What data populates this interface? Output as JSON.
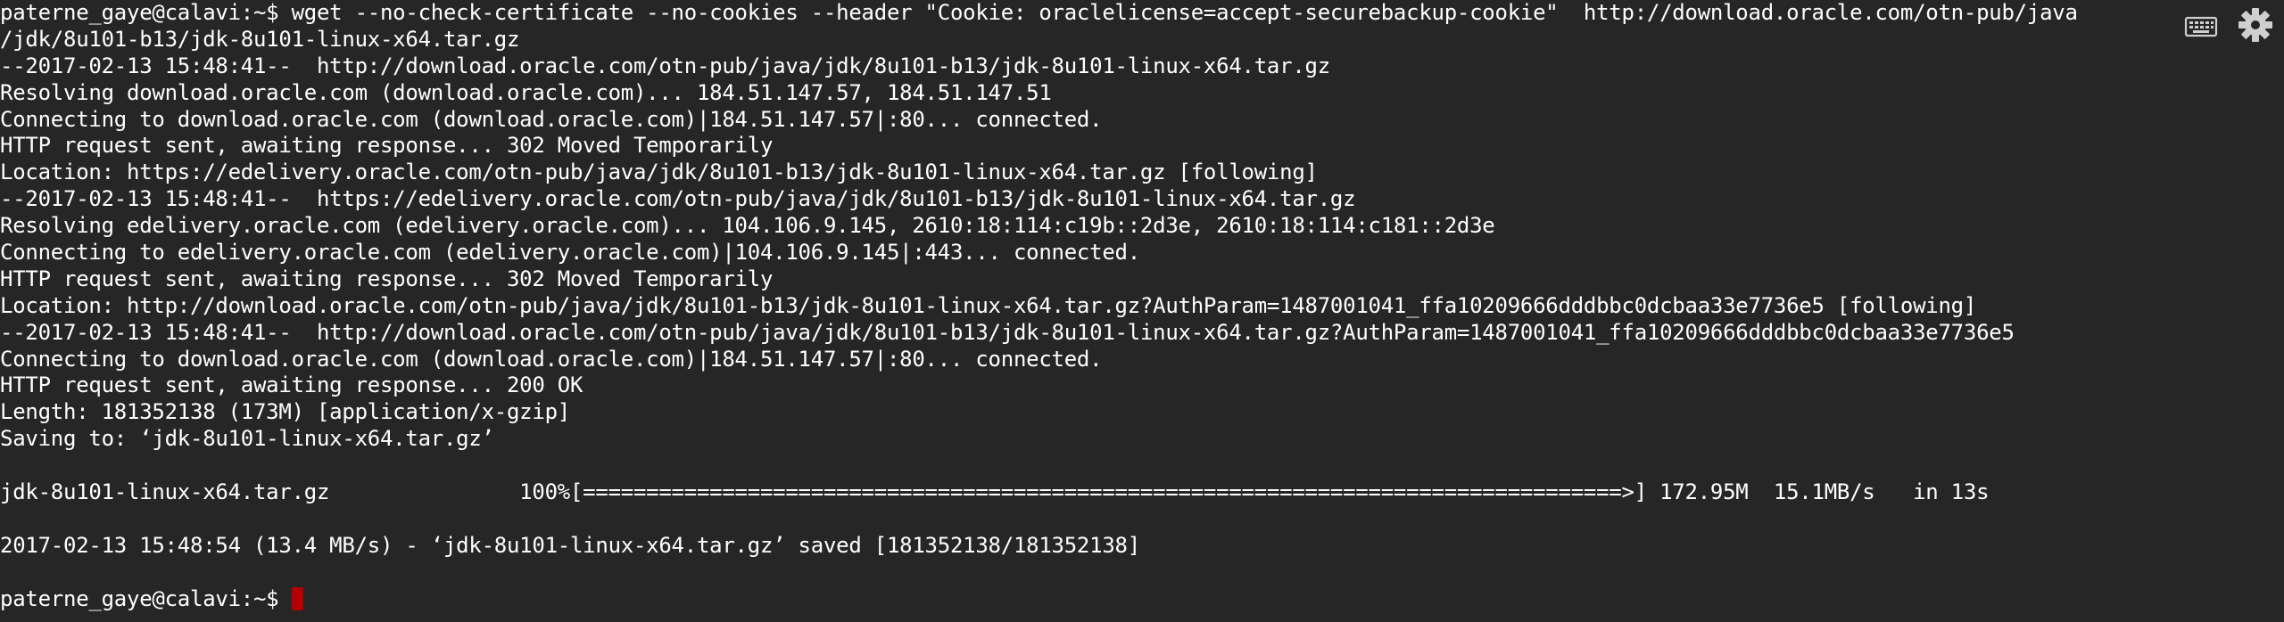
{
  "terminal": {
    "lines": [
      "paterne_gaye@calavi:~$ wget --no-check-certificate --no-cookies --header \"Cookie: oraclelicense=accept-securebackup-cookie\"  http://download.oracle.com/otn-pub/java",
      "/jdk/8u101-b13/jdk-8u101-linux-x64.tar.gz",
      "--2017-02-13 15:48:41--  http://download.oracle.com/otn-pub/java/jdk/8u101-b13/jdk-8u101-linux-x64.tar.gz",
      "Resolving download.oracle.com (download.oracle.com)... 184.51.147.57, 184.51.147.51",
      "Connecting to download.oracle.com (download.oracle.com)|184.51.147.57|:80... connected.",
      "HTTP request sent, awaiting response... 302 Moved Temporarily",
      "Location: https://edelivery.oracle.com/otn-pub/java/jdk/8u101-b13/jdk-8u101-linux-x64.tar.gz [following]",
      "--2017-02-13 15:48:41--  https://edelivery.oracle.com/otn-pub/java/jdk/8u101-b13/jdk-8u101-linux-x64.tar.gz",
      "Resolving edelivery.oracle.com (edelivery.oracle.com)... 104.106.9.145, 2610:18:114:c19b::2d3e, 2610:18:114:c181::2d3e",
      "Connecting to edelivery.oracle.com (edelivery.oracle.com)|104.106.9.145|:443... connected.",
      "HTTP request sent, awaiting response... 302 Moved Temporarily",
      "Location: http://download.oracle.com/otn-pub/java/jdk/8u101-b13/jdk-8u101-linux-x64.tar.gz?AuthParam=1487001041_ffa10209666dddbbc0dcbaa33e7736e5 [following]",
      "--2017-02-13 15:48:41--  http://download.oracle.com/otn-pub/java/jdk/8u101-b13/jdk-8u101-linux-x64.tar.gz?AuthParam=1487001041_ffa10209666dddbbc0dcbaa33e7736e5",
      "Connecting to download.oracle.com (download.oracle.com)|184.51.147.57|:80... connected.",
      "HTTP request sent, awaiting response... 200 OK",
      "Length: 181352138 (173M) [application/x-gzip]",
      "Saving to: ‘jdk-8u101-linux-x64.tar.gz’",
      "",
      "jdk-8u101-linux-x64.tar.gz               100%[==================================================================================>] 172.95M  15.1MB/s   in 13s",
      "",
      "2017-02-13 15:48:54 (13.4 MB/s) - ‘jdk-8u101-linux-x64.tar.gz’ saved [181352138/181352138]",
      ""
    ],
    "prompt": "paterne_gaye@calavi:~$ "
  },
  "icons": {
    "keyboard": "keyboard-icon",
    "settings": "gear-icon"
  },
  "colors": {
    "background": "#262626",
    "foreground": "#ffffff",
    "cursor": "#b30000",
    "icon": "#cfcfcf"
  }
}
